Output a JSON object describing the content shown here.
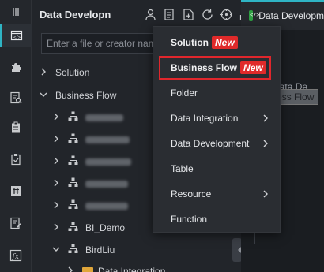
{
  "activity_bar": {
    "items": [
      {
        "icon": "menu-lines-icon"
      },
      {
        "icon": "data-development-icon"
      },
      {
        "icon": "puzzle-icon"
      },
      {
        "icon": "search-document-icon"
      },
      {
        "icon": "clipboard-icon"
      },
      {
        "icon": "clipboard-check-icon"
      },
      {
        "icon": "hash-icon"
      },
      {
        "icon": "edit-document-icon"
      },
      {
        "icon": "function-icon"
      }
    ]
  },
  "explorer": {
    "title": "Data Developn",
    "toolbar_icons": [
      "user-icon",
      "document-icon",
      "new-file-icon",
      "refresh-icon",
      "locate-icon",
      "import-icon"
    ],
    "search_placeholder": "Enter a file or creator name",
    "tree": [
      {
        "label": "Solution",
        "expanded": false
      },
      {
        "label": "Business Flow",
        "expanded": true
      },
      {
        "label": "",
        "blurred": true
      },
      {
        "label": "",
        "blurred": true
      },
      {
        "label": "",
        "blurred": true
      },
      {
        "label": "",
        "blurred": true
      },
      {
        "label": "",
        "blurred": true
      },
      {
        "label": "BI_Demo"
      },
      {
        "label": "BirdLiu",
        "expanded": true
      },
      {
        "label": "Data Integration"
      }
    ]
  },
  "editor": {
    "tab_label": "Data Developm",
    "background_text": "ate Data De",
    "tooltip": "Business Flow"
  },
  "menu": {
    "new_badge": "New",
    "items": [
      {
        "label": "Solution",
        "badge": true
      },
      {
        "label": "Business Flow",
        "badge": true
      },
      {
        "label": "Folder"
      },
      {
        "label": "Data Integration",
        "submenu": true
      },
      {
        "label": "Data Development",
        "submenu": true
      },
      {
        "label": "Table"
      },
      {
        "label": "Resource",
        "submenu": true
      },
      {
        "label": "Function"
      }
    ]
  },
  "colors": {
    "accent": "#2fb4c4",
    "badge": "#e02a2a",
    "highlight_border": "#e0262c"
  }
}
